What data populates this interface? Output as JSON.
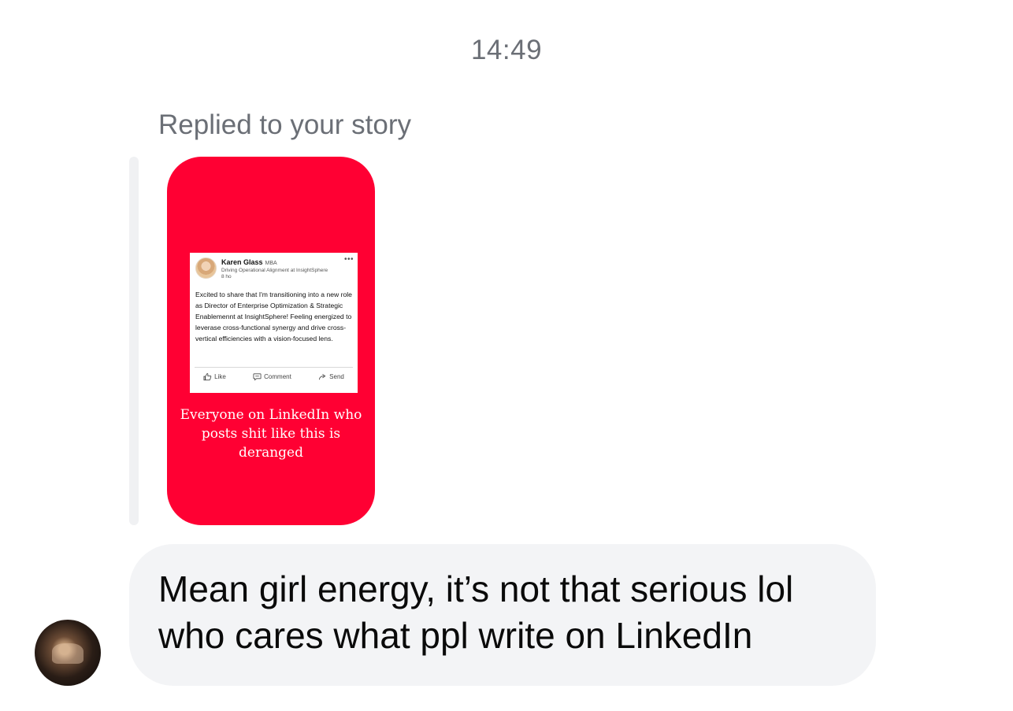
{
  "timestamp": "14:49",
  "reply_caption": "Replied to your story",
  "story": {
    "background_color": "#ff0033",
    "post": {
      "author_name": "Karen Glass",
      "author_badge": "MBA",
      "author_subtitle": "Driving Operational Alignment at InsightSphere",
      "post_age": "8 ho",
      "more_icon": "more-horizontal-icon",
      "body": "Excited to share that I'm transitioning into a new role as Director of Enterprise Optimization & Strategic Enablemennt at InsightSphere! Feeling energized to leverase cross-functional synergy and drive cross-vertical efficiencies with a vision-focused lens.",
      "actions": [
        {
          "label": "Like",
          "icon": "thumbs-up-icon"
        },
        {
          "label": "Comment",
          "icon": "comment-icon"
        },
        {
          "label": "Send",
          "icon": "send-arrow-icon"
        }
      ]
    },
    "caption": "Everyone on LinkedIn who posts shit like this is deranged"
  },
  "message": {
    "text": "Mean girl energy, it’s not that serious lol who cares what ppl write on LinkedIn",
    "bubble_color": "#f3f4f6"
  },
  "sender_avatar": "profile-avatar"
}
